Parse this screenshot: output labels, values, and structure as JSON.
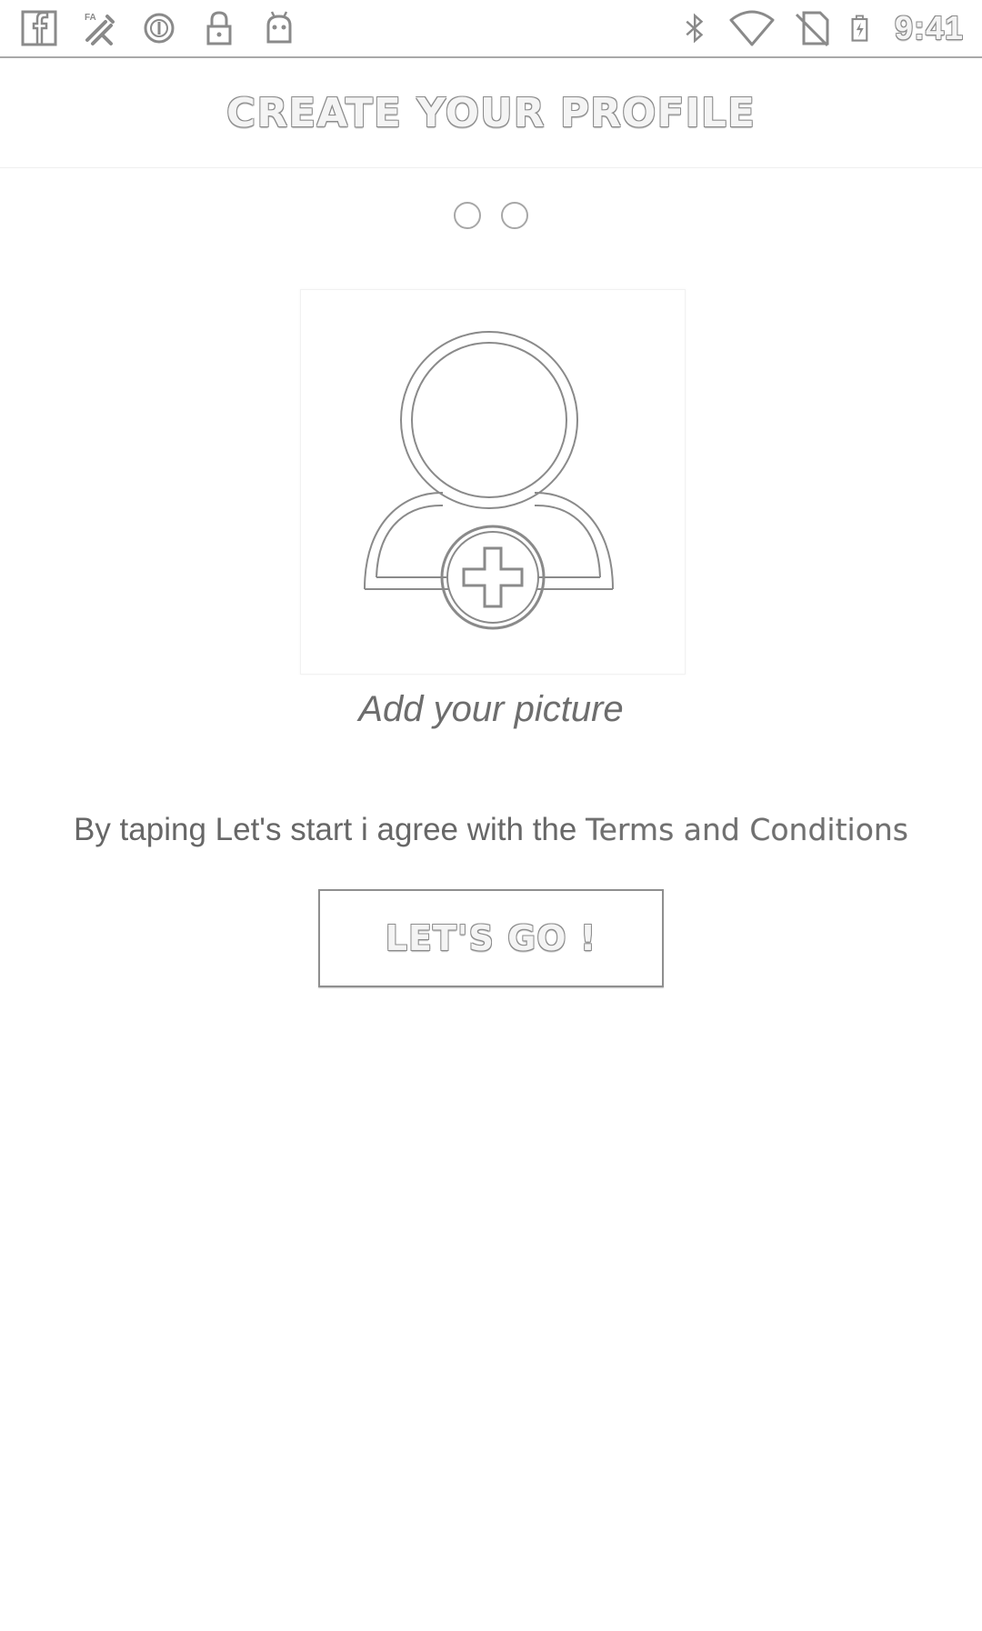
{
  "status_bar": {
    "left_icons": [
      "facebook-icon",
      "tools-icon",
      "data-saver-icon",
      "lock-icon",
      "android-debug-icon"
    ],
    "right_icons": [
      "bluetooth-icon",
      "wifi-icon",
      "no-sim-icon",
      "battery-charging-icon"
    ],
    "time": "9:41"
  },
  "header": {
    "title": "CREATE YOUR PROFILE"
  },
  "pager": {
    "pages": 2
  },
  "avatar": {
    "icon": "add-user-icon",
    "caption": "Add your picture"
  },
  "terms": {
    "prefix": "By taping Let's start i agree with the ",
    "link": "Terms and Conditions"
  },
  "actions": {
    "go_label": "LET'S GO !"
  }
}
